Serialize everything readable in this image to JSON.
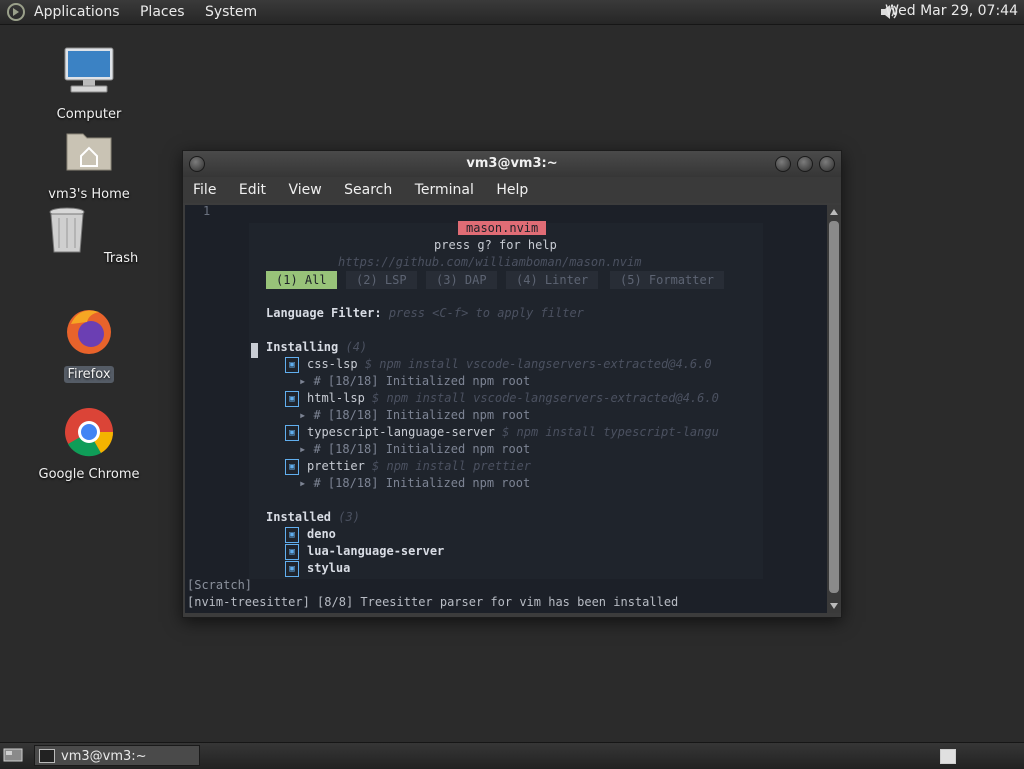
{
  "top_panel": {
    "menus": [
      "Applications",
      "Places",
      "System"
    ],
    "clock": "Wed Mar 29, 07:44"
  },
  "desktop_icons": [
    {
      "label": "Computer",
      "icon": "computer-icon"
    },
    {
      "label": "vm3's Home",
      "icon": "home-folder-icon"
    },
    {
      "label": "Trash",
      "icon": "trash-icon"
    },
    {
      "label": "Firefox",
      "icon": "firefox-icon"
    },
    {
      "label": "Google Chrome",
      "icon": "chrome-icon"
    }
  ],
  "window": {
    "title": "vm3@vm3:~",
    "menus": [
      "File",
      "Edit",
      "View",
      "Search",
      "Terminal",
      "Help"
    ]
  },
  "terminal": {
    "line_number": "1",
    "mason": {
      "title": "mason.nvim",
      "help": "press g? for help",
      "url": "https://github.com/williamboman/mason.nvim",
      "tabs": [
        "(1) All",
        "(2) LSP",
        "(3) DAP",
        "(4) Linter",
        "(5) Formatter"
      ],
      "filter_label": "Language Filter:",
      "filter_hint": "press <C-f> to apply filter",
      "installing_label": "Installing",
      "installing_count": "(4)",
      "installing": [
        {
          "name": "css-lsp",
          "cmd": "$ npm install vscode-langservers-extracted@4.6.0",
          "progress": "▸ # [18/18] Initialized npm root"
        },
        {
          "name": "html-lsp",
          "cmd": "$ npm install vscode-langservers-extracted@4.6.0",
          "progress": "▸ # [18/18] Initialized npm root"
        },
        {
          "name": "typescript-language-server",
          "cmd": "$ npm install typescript-langu",
          "progress": "▸ # [18/18] Initialized npm root"
        },
        {
          "name": "prettier",
          "cmd": "$ npm install prettier",
          "progress": "▸ # [18/18] Initialized npm root"
        }
      ],
      "installed_label": "Installed",
      "installed_count": "(3)",
      "installed": [
        "deno",
        "lua-language-server",
        "stylua"
      ]
    },
    "status_line": "[Scratch]",
    "message_line": "[nvim-treesitter] [8/8] Treesitter parser for vim has been installed"
  },
  "bottom_panel": {
    "task_label": "vm3@vm3:~"
  },
  "colors": {
    "tab_active": "#98c379",
    "title_badge": "#e06c75",
    "terminal_bg": "#1c2028"
  }
}
